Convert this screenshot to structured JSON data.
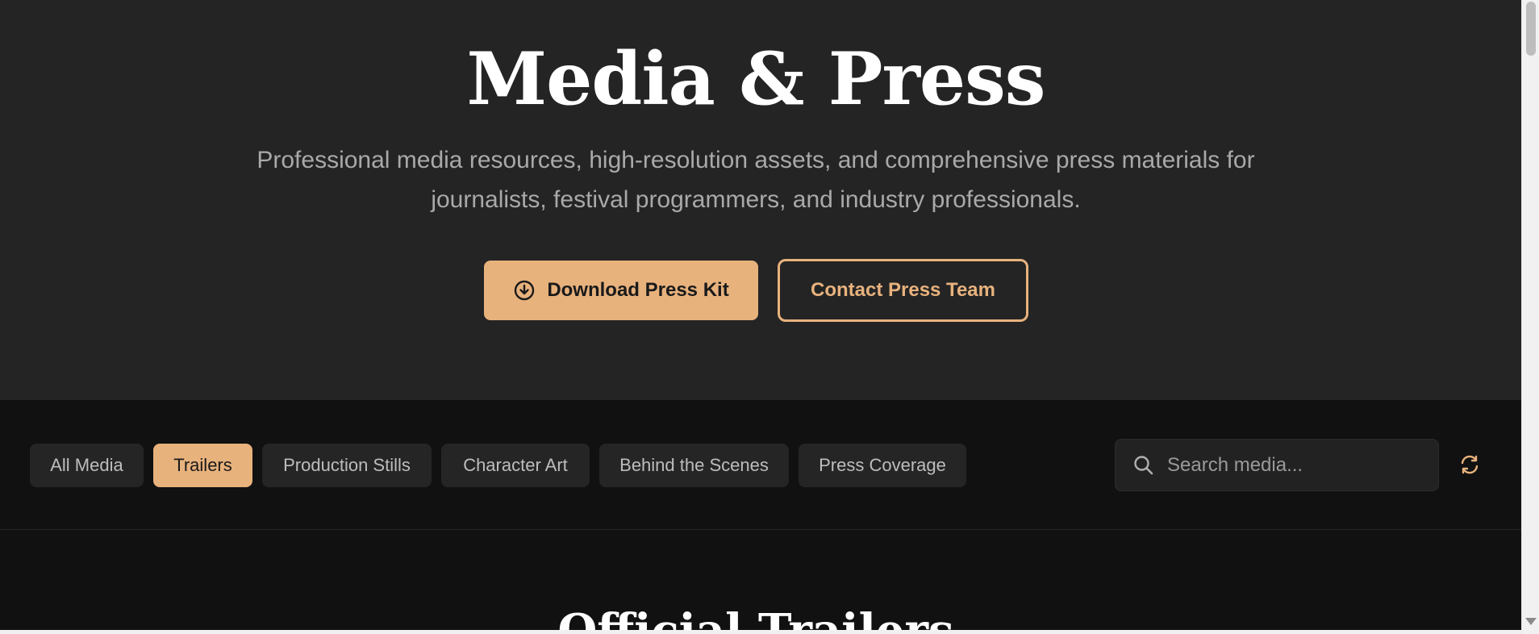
{
  "hero": {
    "title": "Media & Press",
    "subtitle": "Professional media resources, high-resolution assets, and comprehensive press materials for journalists, festival programmers, and industry professionals.",
    "primary_button": {
      "label": "Download Press Kit",
      "icon": "download-circle-icon"
    },
    "secondary_button": {
      "label": "Contact Press Team"
    }
  },
  "filters": {
    "items": [
      {
        "label": "All Media",
        "active": false
      },
      {
        "label": "Trailers",
        "active": true
      },
      {
        "label": "Production Stills",
        "active": false
      },
      {
        "label": "Character Art",
        "active": false
      },
      {
        "label": "Behind the Scenes",
        "active": false
      },
      {
        "label": "Press Coverage",
        "active": false
      }
    ]
  },
  "search": {
    "placeholder": "Search media...",
    "value": "",
    "icon": "search-icon"
  },
  "refresh": {
    "icon": "refresh-icon"
  },
  "section": {
    "title": "Official Trailers"
  },
  "colors": {
    "accent": "#e8b27d",
    "hero_bg": "#242424",
    "page_bg": "#111111",
    "pill_bg": "#252525"
  }
}
